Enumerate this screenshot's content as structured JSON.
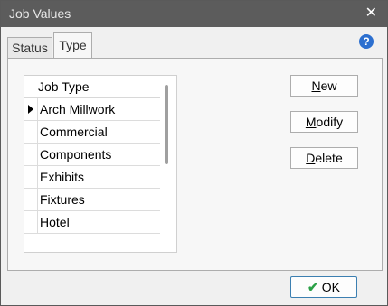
{
  "window": {
    "title": "Job Values",
    "close_glyph": "✕"
  },
  "tabs": [
    {
      "label": "Status",
      "active": false
    },
    {
      "label": "Type",
      "active": true
    }
  ],
  "help": {
    "glyph": "?",
    "icon": "help-icon",
    "color": "#2c6fcf"
  },
  "grid": {
    "header": "Job Type",
    "rows": [
      {
        "label": "Arch Millwork",
        "current": true
      },
      {
        "label": "Commercial"
      },
      {
        "label": "Components"
      },
      {
        "label": "Exhibits"
      },
      {
        "label": "Fixtures"
      },
      {
        "label": "Hotel"
      }
    ]
  },
  "buttons": {
    "new": {
      "mnemonic": "N",
      "rest": "ew"
    },
    "modify": {
      "mnemonic": "M",
      "rest": "odify"
    },
    "delete": {
      "mnemonic": "D",
      "rest": "elete"
    }
  },
  "ok": {
    "label": "OK",
    "icon": "check-icon",
    "check_glyph": "✔",
    "check_color": "#2aa046"
  }
}
